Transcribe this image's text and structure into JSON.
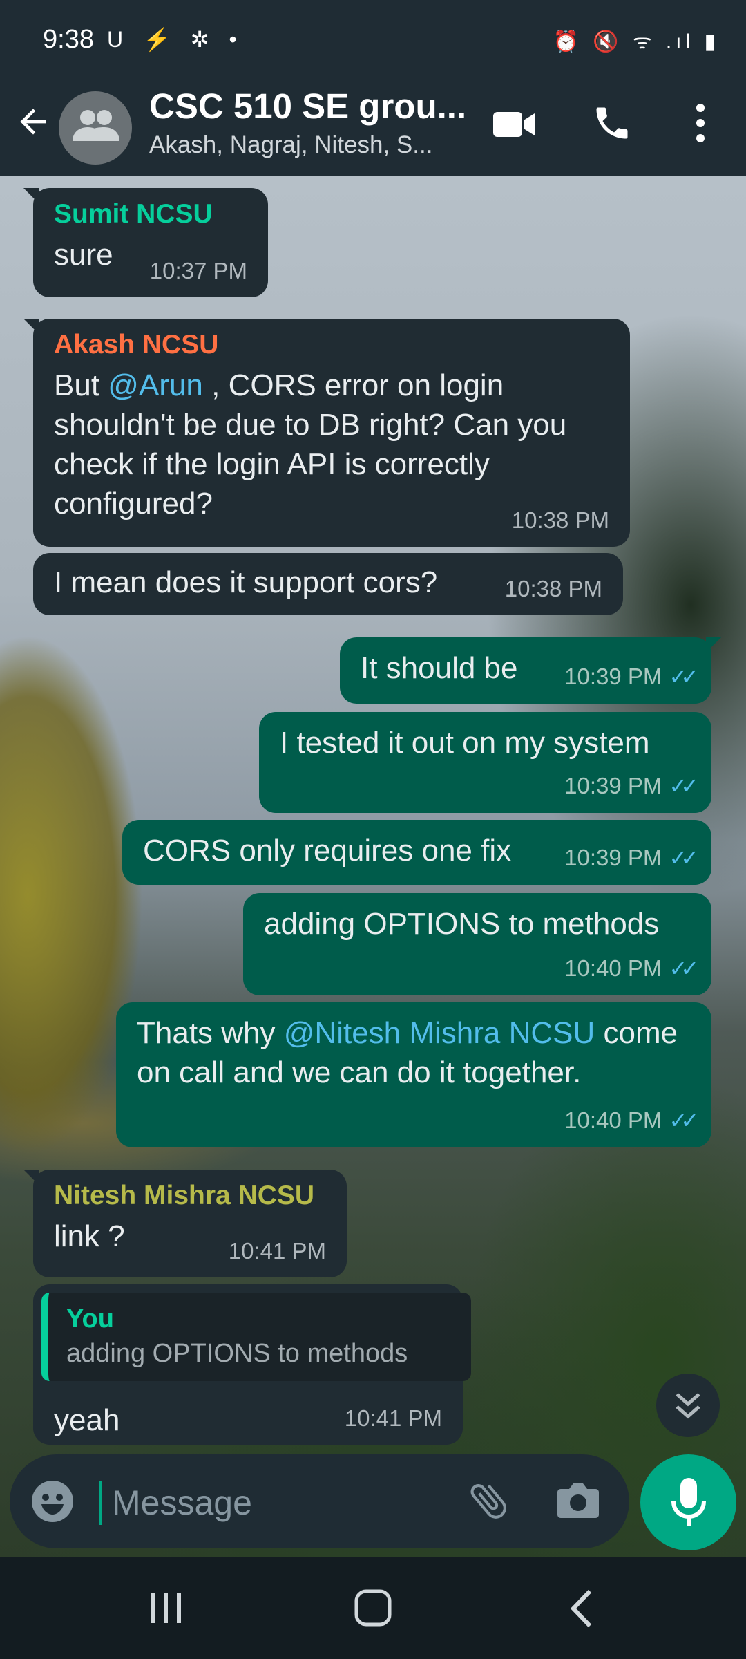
{
  "status_bar": {
    "time": "9:38",
    "left_icons": "U ⚡ ✲ •",
    "right_icons": "⏰ 🔇 ᯤ .ıl ▮"
  },
  "header": {
    "title": "CSC 510 SE grou...",
    "subtitle": "Akash, Nagraj, Nitesh, S..."
  },
  "colors": {
    "incoming_bubble": "#202c33",
    "outgoing_bubble": "#005c4b",
    "sender_sumit": "#06cf9c",
    "sender_akash": "#ff7043",
    "sender_nitesh": "#b6ba4a",
    "mention": "#53bdeb",
    "accent": "#00a884"
  },
  "messages": [
    {
      "sender": "Sumit NCSU",
      "text": "sure",
      "time": "10:37 PM"
    },
    {
      "sender": "Akash NCSU",
      "text_pre": "But ",
      "mention": "@Arun",
      "text_post": " , CORS error on login shouldn't be due to DB right? Can you check if the login API is correctly configured?",
      "time": "10:38 PM"
    },
    {
      "text": "I mean does it support cors?",
      "time": "10:38 PM"
    },
    {
      "text": "It should be",
      "time": "10:39 PM",
      "ticks": "✓✓"
    },
    {
      "text": "I tested it out on my system",
      "time": "10:39 PM",
      "ticks": "✓✓"
    },
    {
      "text": "CORS only requires one fix",
      "time": "10:39 PM",
      "ticks": "✓✓"
    },
    {
      "text": "adding OPTIONS to methods",
      "time": "10:40 PM",
      "ticks": "✓✓"
    },
    {
      "text_pre": "Thats why ",
      "mention": "@Nitesh Mishra NCSU",
      "text_post": " come on call and we can do it together.",
      "time": "10:40 PM",
      "ticks": "✓✓"
    },
    {
      "sender": "Nitesh Mishra NCSU",
      "text": "link ?",
      "time": "10:41 PM"
    },
    {
      "quote_author": "You",
      "quote_text": "adding OPTIONS to methods",
      "text": "yeah",
      "time": "10:41 PM"
    }
  ],
  "input": {
    "placeholder": "Message"
  },
  "icons": {
    "back": "arrow-left",
    "video": "video-camera",
    "call": "phone",
    "menu": "more-vertical",
    "emoji": "emoji-smile",
    "attach": "paperclip",
    "camera": "camera",
    "mic": "microphone",
    "scroll": "double-chevron-down",
    "nav_recents": "recents",
    "nav_home": "home",
    "nav_back": "back"
  }
}
